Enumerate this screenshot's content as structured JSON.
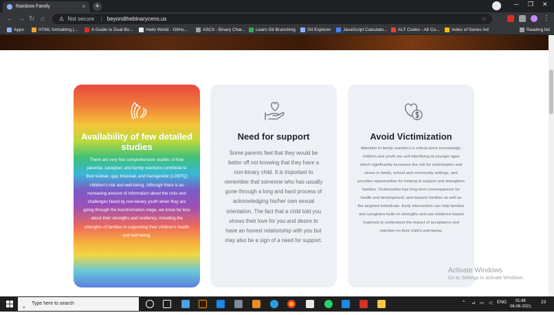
{
  "browser": {
    "tab_title": "Rainbow Family",
    "tab_close": "×",
    "new_tab": "+",
    "not_secure": "Not secure",
    "url": "beyondthebinarycens.us",
    "reading_list": "Reading list",
    "bookmarks": [
      {
        "label": "Apps",
        "color": "#8ab4f8"
      },
      {
        "label": "HTML formatting |...",
        "color": "#f2a33a"
      },
      {
        "label": "A Guide to Dual Bo...",
        "color": "#d93025"
      },
      {
        "label": "Hello World · GitHu...",
        "color": "#e8eaed"
      },
      {
        "label": "ASCII - Binary Char...",
        "color": "#9aa0a6"
      },
      {
        "label": "Learn Git Branching",
        "color": "#34a853"
      },
      {
        "label": "Git Explorer",
        "color": "#8ab4f8"
      },
      {
        "label": "JavaScript Calculato...",
        "color": "#4285f4"
      },
      {
        "label": "ALT Codes - Alt Co...",
        "color": "#ea4335"
      },
      {
        "label": "Index of Series /vd",
        "color": "#fbbc04"
      }
    ]
  },
  "cards": [
    {
      "title": "Availability of few detailed studies",
      "icon": "hands-icon",
      "body": "There are very few comprehensive studies of how parental, caregiver, and family reactions contribute to their lesbian, gay, bisexual, and transgender (LGBTQ) children's risk and well-being. Although there is an increasing amount of information about the risks and challenges faced by non-binary youth when they are going through the transformation stage, we know far less about their strengths and resiliency, including the strengths of families in supporting their children's health and well-being."
    },
    {
      "title": "Need for support",
      "icon": "heart-in-hand-icon",
      "body": "Some parents feel that they would be better off not knowing that they have a non-binary child. It is important to remember that someone who has usually gone through a long and hard process of acknowledging his/her own sexual orientation. The fact that a child told you shows their love for you and desire to have an honest relationship with you but may also be a sign of a need for support."
    },
    {
      "title": "Avoid Victimization",
      "icon": "heart-coin-icon",
      "body": "Attention to family reactions is critical since increasingly, children and youth are self-identifying at younger ages which significantly increases the risk for victimization and stress in family, school and community settings, and provides opportunities for helping to support and strengthen families. Victimization has long-term consequences for health and development, and impacts families as well as the targeted individuals. Early intervention can help families and caregivers build on strengths and use evidence-based materials to understand the impact of acceptance and rejection on their child's well-being."
    }
  ],
  "watermark": {
    "line1": "Activate Windows",
    "line2": "Go to Settings to activate Windows."
  },
  "taskbar": {
    "search_placeholder": "Type here to search",
    "lang": "ENG",
    "time": "01:46",
    "date": "06-06-2021",
    "notif": "23"
  }
}
